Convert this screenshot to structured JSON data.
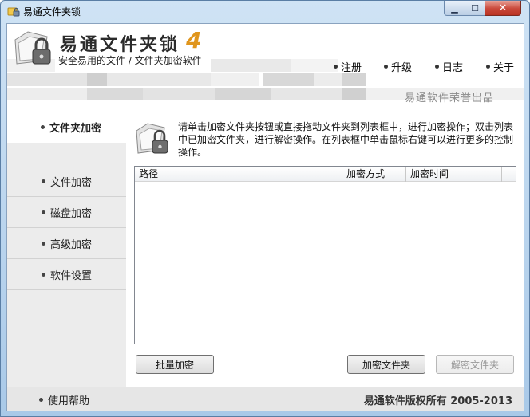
{
  "window": {
    "title": "易通文件夹锁",
    "close_glyph": "✕",
    "minimize_glyph": "▁",
    "maximize_glyph": "☐"
  },
  "header": {
    "app_name": "易通文件夹锁",
    "version": "4",
    "tagline": "安全易用的文件 / 文件夹加密软件",
    "menu": [
      "注册",
      "升级",
      "日志",
      "关于"
    ],
    "brand": "易通软件荣誉出品"
  },
  "sidebar": {
    "items": [
      {
        "label": "文件夹加密",
        "active": true
      },
      {
        "label": "文件加密",
        "active": false
      },
      {
        "label": "磁盘加密",
        "active": false
      },
      {
        "label": "高级加密",
        "active": false
      },
      {
        "label": "软件设置",
        "active": false
      }
    ],
    "help": "使用帮助"
  },
  "main": {
    "instructions": "请单击加密文件夹按钮或直接拖动文件夹到列表框中，进行加密操作；双击列表中已加密文件夹，进行解密操作。在列表框中单击鼠标右键可以进行更多的控制操作。",
    "columns": [
      "路径",
      "加密方式",
      "加密时间"
    ],
    "buttons": {
      "batch": "批量加密",
      "encrypt_folder": "加密文件夹",
      "decrypt_folder": "解密文件夹"
    }
  },
  "footer": {
    "copyright": "易通软件版权所有 2005-2013"
  },
  "colors": {
    "accent_orange": "#e0951c",
    "close_red": "#c9483a",
    "sidebar_bg": "#ececec"
  },
  "icons": {
    "app": "folder-lock-icon",
    "logo": "folder-lock-icon",
    "info": "folder-lock-icon",
    "menu_bullet": "dot-icon"
  }
}
